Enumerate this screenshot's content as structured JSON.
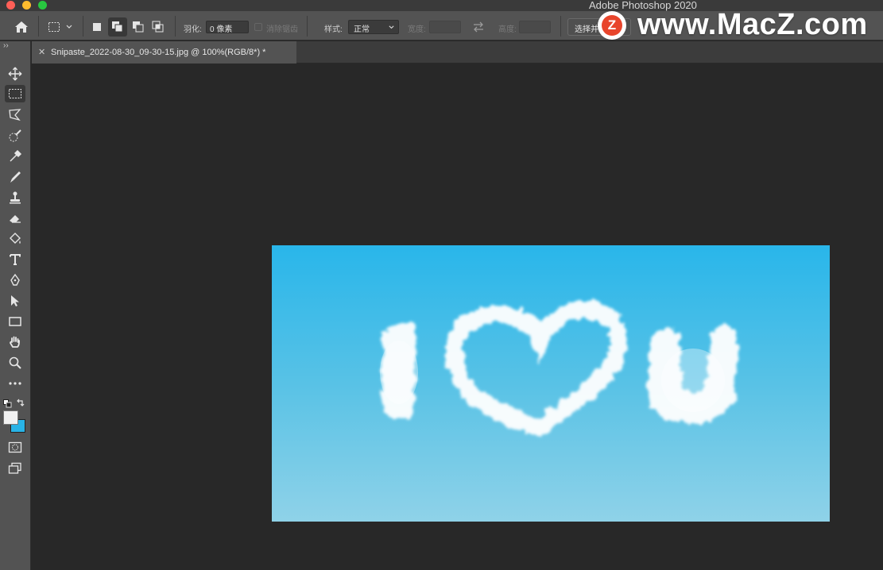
{
  "window": {
    "title": "Adobe Photoshop 2020"
  },
  "options_bar": {
    "feather_label": "羽化:",
    "feather_value": "0 像素",
    "antialias_label": "消除锯齿",
    "style_label": "样式:",
    "style_value": "正常",
    "width_label": "宽度:",
    "height_label": "高度:",
    "select_mask_button": "选择并遮住..."
  },
  "document_tab": {
    "label": "Snipaste_2022-08-30_09-30-15.jpg @ 100%(RGB/8*) *"
  },
  "watermark": {
    "badge_letter": "Z",
    "text": "www.MacZ.com"
  },
  "tools": [
    "move-tool",
    "rectangular-marquee-tool",
    "lasso-tool",
    "quick-selection-tool",
    "eyedropper-tool",
    "brush-tool",
    "clone-stamp-tool",
    "eraser-tool",
    "paint-bucket-tool",
    "type-tool",
    "pen-tool",
    "path-selection-tool",
    "rectangle-tool",
    "hand-tool",
    "zoom-tool",
    "more-tools"
  ],
  "colors": {
    "foreground": "#f2f2f2",
    "background": "#29b3e6",
    "sky_top": "#29b6ea",
    "sky_bottom": "#8fd2e8"
  }
}
